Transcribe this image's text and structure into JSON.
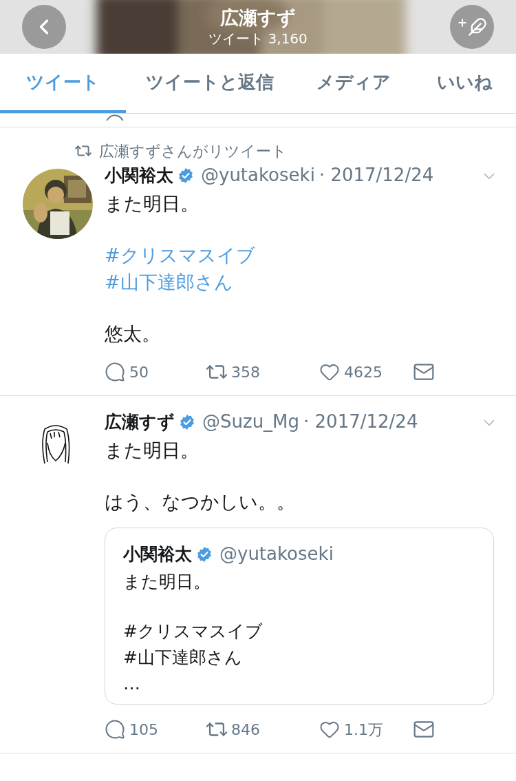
{
  "header": {
    "title": "広瀬すず",
    "subtitle": "ツイート 3,160"
  },
  "tabs": [
    {
      "label": "ツイート",
      "selected": true
    },
    {
      "label": "ツイートと返信",
      "selected": false
    },
    {
      "label": "メディア",
      "selected": false
    },
    {
      "label": "いいね",
      "selected": false
    }
  ],
  "tweets": [
    {
      "retweeted_by": "広瀬すずさんがリツイート",
      "avatar": {
        "kind": "picture"
      },
      "name": "小関裕太",
      "verified": true,
      "handle": "@yutakoseki",
      "date": "· 2017/12/24",
      "paragraphs": [
        [
          {
            "text": "また明日。",
            "kind": "text"
          }
        ],
        [
          {
            "text": "#クリスマスイブ",
            "kind": "hashtag"
          },
          {
            "text": "#山下達郎さん",
            "kind": "hashtag"
          }
        ],
        [
          {
            "text": "悠太。",
            "kind": "text"
          }
        ]
      ],
      "actions": {
        "replies": "50",
        "retweets": "358",
        "likes": "4625"
      }
    },
    {
      "avatar": {
        "kind": "drawing"
      },
      "name": "広瀬すず",
      "verified": true,
      "handle": "@Suzu_Mg",
      "date": "· 2017/12/24",
      "paragraphs": [
        [
          {
            "text": "また明日。",
            "kind": "text"
          }
        ],
        [
          {
            "text": "はう、なつかしい。。",
            "kind": "text"
          }
        ]
      ],
      "quote": {
        "name": "小関裕太",
        "verified": true,
        "handle": "@yutakoseki",
        "paragraphs": [
          [
            {
              "text": "また明日。",
              "kind": "text"
            }
          ],
          [
            {
              "text": "#クリスマスイブ",
              "kind": "text"
            },
            {
              "text": "#山下達郎さん",
              "kind": "text"
            },
            {
              "text": "…",
              "kind": "text"
            }
          ]
        ]
      },
      "actions": {
        "replies": "105",
        "retweets": "846",
        "likes": "1.1万"
      }
    }
  ]
}
